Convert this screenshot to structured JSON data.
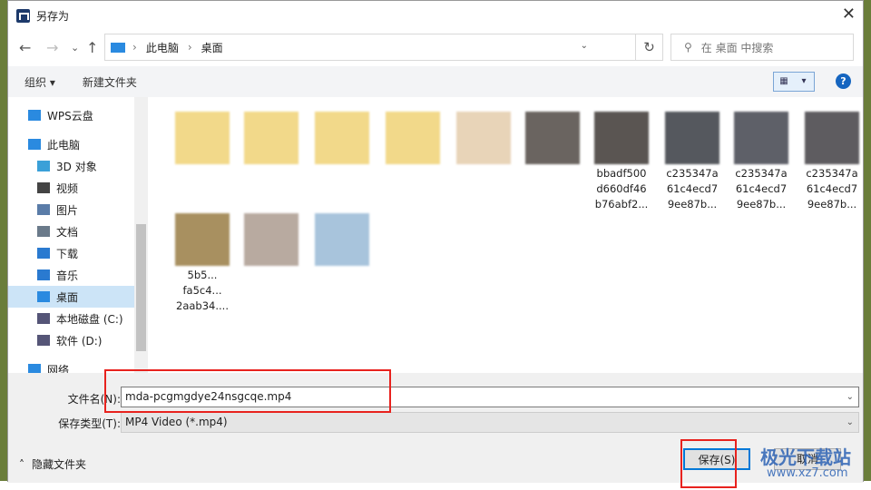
{
  "window": {
    "title": "另存为",
    "close": "✕"
  },
  "nav": {
    "back": "←",
    "forward": "→",
    "recent": "⌄",
    "up": "↑",
    "breadcrumb": [
      "此电脑",
      "桌面"
    ],
    "refresh": "↻",
    "search_placeholder": "在 桌面 中搜索"
  },
  "toolbar": {
    "organize": "组织 ▾",
    "new_folder": "新建文件夹",
    "help": "?"
  },
  "sidebar": {
    "items": [
      {
        "label": "WPS云盘",
        "icon": "cloud-icon",
        "color": "#2a8ae0"
      },
      {
        "label": "此电脑",
        "icon": "computer-icon",
        "color": "#2a8ae0"
      },
      {
        "label": "3D 对象",
        "icon": "cube-icon",
        "color": "#3aa0d8"
      },
      {
        "label": "视频",
        "icon": "video-icon",
        "color": "#444"
      },
      {
        "label": "图片",
        "icon": "picture-icon",
        "color": "#5a7ca8"
      },
      {
        "label": "文档",
        "icon": "document-icon",
        "color": "#6a7a8a"
      },
      {
        "label": "下载",
        "icon": "download-icon",
        "color": "#2a7ad0"
      },
      {
        "label": "音乐",
        "icon": "music-icon",
        "color": "#2a7ad0"
      },
      {
        "label": "桌面",
        "icon": "desktop-icon",
        "color": "#2a8ae0",
        "selected": true
      },
      {
        "label": "本地磁盘 (C:)",
        "icon": "drive-icon",
        "color": "#557"
      },
      {
        "label": "软件 (D:)",
        "icon": "drive-icon",
        "color": "#557"
      },
      {
        "label": "网络",
        "icon": "network-icon",
        "color": "#2a8ae0"
      }
    ]
  },
  "files": [
    {
      "label": "",
      "thumb": "#f2d98a"
    },
    {
      "label": "",
      "thumb": "#f2d98a"
    },
    {
      "label": "",
      "thumb": "#f2d98a"
    },
    {
      "label": "",
      "thumb": "#f2d98a"
    },
    {
      "label": "",
      "thumb": "#e8d4b8"
    },
    {
      "label": "",
      "thumb": "#6a6460"
    },
    {
      "label": "bbadf500 d660df46 b76abf2...",
      "thumb": "#5a5552"
    },
    {
      "label": "c235347a 61c4ecd7 9ee87b...",
      "thumb": "#55585e"
    },
    {
      "label": "c235347a 61c4ecd7 9ee87b...",
      "thumb": "#5e6068"
    },
    {
      "label": "c235347a 61c4ecd7 9ee87b...",
      "thumb": "#5e5c60"
    },
    {
      "label": "5b5... fa5c4... 2aab34....",
      "thumb": "#a89060"
    },
    {
      "label": "",
      "thumb": "#b8aaa0"
    },
    {
      "label": "",
      "thumb": "#a8c4dc"
    }
  ],
  "form": {
    "filename_label": "文件名(N):",
    "filename_value": "mda-pcgmgdye24nsgcqe.mp4",
    "type_label": "保存类型(T):",
    "type_value": "MP4 Video (*.mp4)",
    "hide_folders": "隐藏文件夹",
    "save": "保存(S)",
    "cancel": "取消"
  },
  "watermark": {
    "text": "极光下载站",
    "url": "www.xz7.com"
  },
  "highlight_color": "#e8221e"
}
